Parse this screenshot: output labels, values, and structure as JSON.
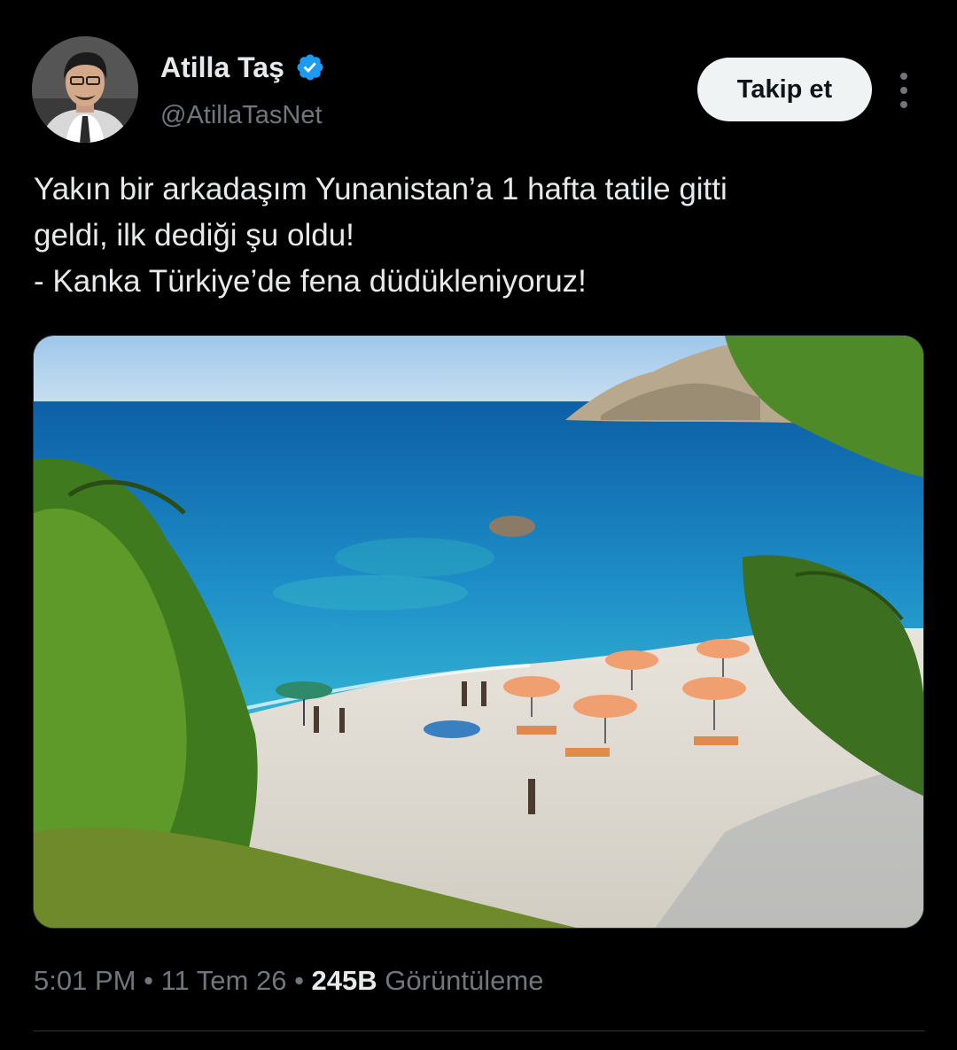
{
  "author": {
    "display_name": "Atilla Taş",
    "handle": "@AtillaTasNet",
    "verified": true
  },
  "actions": {
    "follow_label": "Takip et",
    "more_icon": "more-vertical-icon"
  },
  "tweet": {
    "lines": [
      "Yakın bir arkadaşım Yunanistan’a 1 hafta tatile gitti",
      "geldi, ilk dediği şu oldu!",
      "- Kanka Türkiye’de fena düdükleniyoruz!"
    ]
  },
  "meta": {
    "time": "5:01 PM",
    "separator1": " • ",
    "date": "11 Tem 26",
    "separator2": " • ",
    "views_count": "245B",
    "views_label": " Görüntüleme"
  },
  "colors": {
    "background": "#000000",
    "text_primary": "#e7e9ea",
    "text_secondary": "#71767b",
    "verified_badge": "#1d9bf0",
    "follow_button_bg": "#eff3f4",
    "divider": "#2f3336"
  }
}
